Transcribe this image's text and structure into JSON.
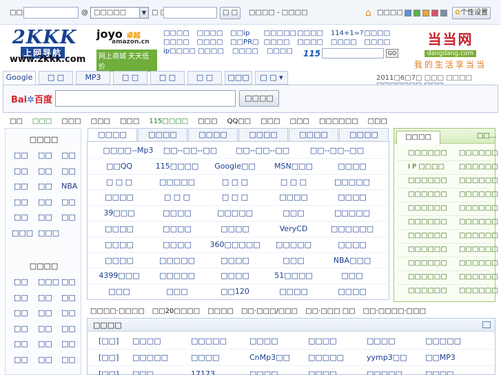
{
  "topbar": {
    "mail_label": "□□□",
    "at_sign": "@",
    "mail_domain": "□□□□□",
    "password_label": "□ □",
    "login_button": "□ □",
    "links": "□□□□ - □□□□",
    "home_link": "□□□□",
    "settings_button": "个性设置",
    "swatch_colors": [
      "#5a8fd8",
      "#59b24a",
      "#e8a43a",
      "#d9536a",
      "#7d8fa8"
    ]
  },
  "header": {
    "logo_main": "2KKK",
    "logo_sub": "上网导航",
    "logo_url": "www.2kkk.com",
    "joyo_name": "joyo",
    "joyo_cn": "卓越",
    "joyo_domain": "amazon.cn",
    "joyo_tag": "网上商城 天天低价",
    "quick_links": [
      [
        "□□□□",
        "□□□□",
        "□□ip",
        "□□□□□",
        "□□□□",
        "114+1=?",
        "□□□□"
      ],
      [
        "□□□□",
        "□□□□",
        "□□PR□",
        "□□□□",
        "□□□□",
        "□□□□",
        "□□□□"
      ],
      [
        "ip□□□□",
        "□□□□",
        "□□□□",
        "□□□□"
      ]
    ],
    "ql_115": "115",
    "ql_go": "GO",
    "dangdang_title": "当当网",
    "dangdang_sub": "dangdang.com",
    "dangdang_slogan": "我的生活享当当"
  },
  "search_tabs": [
    "Google",
    "□ □",
    "MP3",
    "□ □",
    "□ □",
    "□ □",
    "□□□",
    "□ □ ▾"
  ],
  "date_text": "2011□6□7□  □□□ □□□□",
  "date_link": "□□□□□□□ □□□...",
  "search": {
    "logo_a": "Bai",
    "logo_b": "百度",
    "button": "□□□□"
  },
  "nav_row": [
    {
      "t": "□□",
      "hl": false
    },
    {
      "t": "□□□",
      "hl": true
    },
    {
      "t": "□□□",
      "hl": false
    },
    {
      "t": "□□□",
      "hl": false
    },
    {
      "t": "□□□",
      "hl": false
    },
    {
      "t": "115□□□□",
      "hl": true
    },
    {
      "t": "□□□",
      "hl": false
    },
    {
      "t": "QQ□□",
      "hl": false
    },
    {
      "t": "□□□",
      "hl": false
    },
    {
      "t": "□□□",
      "hl": false
    },
    {
      "t": "□□□□□□",
      "hl": false
    },
    {
      "t": "□□□",
      "hl": false
    }
  ],
  "left": {
    "title1": "□□□□",
    "rows1": [
      [
        "□□",
        "□□",
        "□□"
      ],
      [
        "□□",
        "□□",
        "□□"
      ],
      [
        "□□",
        "□□",
        "NBA"
      ],
      [
        "□□",
        "□□",
        "□□"
      ],
      [
        "□□",
        "□□",
        "□□"
      ],
      [
        "□□□",
        "□□□"
      ]
    ],
    "title2": "□□□□",
    "rows2": [
      [
        "□□",
        "□□□",
        "□□"
      ],
      [
        "□□",
        "□□",
        "□□"
      ],
      [
        "□□",
        "□□",
        "□□"
      ],
      [
        "□□",
        "□□",
        "□□"
      ],
      [
        "□□",
        "□□",
        "□□"
      ],
      [
        "□□",
        "□□",
        "□□"
      ]
    ]
  },
  "center": {
    "tabs": [
      "□□□□",
      "□□□□",
      "□□□□",
      "□□□□",
      "□□□□",
      "□□□□"
    ],
    "rows": [
      [
        "□□□□--Mp3",
        "□□--□□--□□",
        "□□--□□--□□",
        "□□--□□--□□"
      ],
      [
        "□□QQ",
        "115□□□□",
        "Google□□",
        "MSN□□□",
        "□□□□"
      ],
      [
        "□ □ □",
        "□□□□□",
        "□ □ □",
        "□ □ □",
        "□□□□□"
      ],
      [
        "□□□□",
        "□ □ □",
        "□ □ □",
        "□□□□",
        "□□□□"
      ],
      [
        "39□□□",
        "□□□□",
        "□□□□□",
        "□□□",
        "□□□□□"
      ],
      [
        "□□□□",
        "□□□□",
        "□□□□",
        "VeryCD",
        "□□□□□□"
      ],
      [
        "□□□□",
        "□□□□",
        "360□□□□□",
        "□□□□□",
        "□□□□"
      ],
      [
        "□□□□",
        "□□□□□",
        "□□□□",
        "□□□",
        "NBA□□□"
      ],
      [
        "4399□□□",
        "□□□□□",
        "□□□□",
        "51□□□□",
        "□□□"
      ],
      [
        "□□□",
        "□□□",
        "□□120",
        "□□□□",
        "□□□□"
      ]
    ],
    "bottom_links": [
      "□□□□·□□□□",
      "□□20□□□□",
      "□□□□",
      "□□·□□□/□□□",
      "□□·□□□ □□",
      "□□·□□□□·□□□"
    ]
  },
  "list": {
    "title": "□□□□",
    "rows": [
      [
        "[□□]",
        "□□□□",
        "□□□□□",
        "□□□□",
        "□□□□",
        "□□□□",
        "□□□□□"
      ],
      [
        "[□□]",
        "□□□□□",
        "□□□□",
        "CnMp3□□",
        "□□□□□",
        "yymp3□□",
        "□□MP3"
      ],
      [
        "[□□]",
        "□□□",
        "17173",
        "□□□□",
        "□□□□",
        "□□□□□",
        "□□□□"
      ]
    ]
  },
  "right": {
    "tab": "□□□□",
    "more": "□□...",
    "rows": [
      [
        "□□□□□□",
        "□□□□□□"
      ],
      [
        "I P □□□□",
        "□□□□□□"
      ],
      [
        "□□□□□□",
        "□□□□□□"
      ],
      [
        "□□□□□□",
        "□□□□□□"
      ],
      [
        "□□□□□□",
        "□□□□□□"
      ],
      [
        "□□□□□□",
        "□□□□□□"
      ],
      [
        "□□□□□□",
        "□□□□□□"
      ],
      [
        "□□□□□□",
        "□□□□□□"
      ],
      [
        "□□□□□□",
        "□□□□□□"
      ],
      [
        "□□□□□□",
        "□□□□□□"
      ],
      [
        "□□□□□□",
        "□□□□□□"
      ]
    ]
  }
}
